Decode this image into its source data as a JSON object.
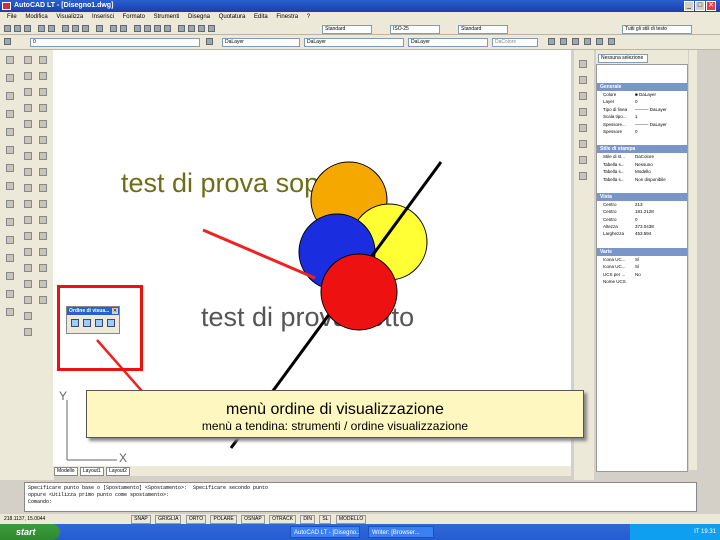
{
  "window": {
    "title": "AutoCAD LT - [Disegno1.dwg]",
    "minimize": "_",
    "maximize": "□",
    "close": "✕"
  },
  "menu": [
    "File",
    "Modifica",
    "Visualizza",
    "Inserisci",
    "Formato",
    "Strumenti",
    "Disegna",
    "Quotatura",
    "Edita",
    "Finestra",
    "?"
  ],
  "toolbar": {
    "text_style": "Standard",
    "dim_style": "ISO-25",
    "table_style": "Standard",
    "layer": "0",
    "color": "DaLayer",
    "linetype": "DaLayer",
    "lineweight": "DaLayer",
    "plotstyle": "DaColore",
    "right_combo": "Tutti gli stili di testo"
  },
  "drawing": {
    "text_top": "test di prova sopra",
    "text_bottom": "test di prova sotto",
    "circles": [
      {
        "name": "orange",
        "color": "#f5a800"
      },
      {
        "name": "yellow",
        "color": "#ffff33"
      },
      {
        "name": "blue",
        "color": "#1a2ee0"
      },
      {
        "name": "red",
        "color": "#ee1111"
      }
    ],
    "axis_x": "X",
    "axis_y": "Y"
  },
  "order_toolbar": {
    "title": "Ordine di visua...",
    "close": "✕"
  },
  "caption": {
    "title": "menù ordine di visualizzazione",
    "subtitle": "menù a tendina: strumenti / ordine visualizzazione"
  },
  "layout_tabs": [
    "Modello",
    "Layout1",
    "Layout2"
  ],
  "properties": {
    "selector": "Nessuna selezione",
    "sections": [
      {
        "title": "Generale",
        "rows": [
          [
            "Colore",
            "■ DaLayer"
          ],
          [
            "Layer",
            "0"
          ],
          [
            "Tipo di linea",
            "——— DaLayer"
          ],
          [
            "Scala tipo...",
            "1"
          ],
          [
            "Spessore...",
            "——— DaLayer"
          ],
          [
            "Spessore",
            "0"
          ]
        ]
      },
      {
        "title": "Stile di stampa",
        "rows": [
          [
            "Stile di st...",
            "DaColore"
          ],
          [
            "Tabella s...",
            "Nessuno"
          ],
          [
            "Tabella s...",
            "Modello"
          ],
          [
            "Tabella s...",
            "Non disponibile"
          ]
        ]
      },
      {
        "title": "Vista",
        "rows": [
          [
            "Centro",
            "213"
          ],
          [
            "Centro",
            "181.2128"
          ],
          [
            "Centro",
            "0"
          ],
          [
            "Altezza",
            "373.0438"
          ],
          [
            "Larghezza",
            "453.594"
          ]
        ]
      },
      {
        "title": "Varie",
        "rows": [
          [
            "Icona UC...",
            "Sì"
          ],
          [
            "Icona UC...",
            "Sì"
          ],
          [
            "UCS per ...",
            "No"
          ],
          [
            "Nome UCS",
            ""
          ]
        ]
      }
    ]
  },
  "command": {
    "line1": "Specificare punto base o [Spostamento] <Spostamento>:  Specificare secondo punto",
    "line2": "oppure <Utilizza primo punto come spostamento>:",
    "line3": "Comando:"
  },
  "status": {
    "coords": "218.1137, 15.0044",
    "buttons": [
      "SNAP",
      "GRIGLIA",
      "ORTO",
      "POLARE",
      "OSNAP",
      "OTRACK",
      "DIN",
      "SL",
      "MODELLO"
    ]
  },
  "taskbar": {
    "start": "start",
    "tasks": [
      "AutoCAD LT - [Disegno...",
      "Writer: [Browser..."
    ],
    "tray": "IT  19.31"
  }
}
